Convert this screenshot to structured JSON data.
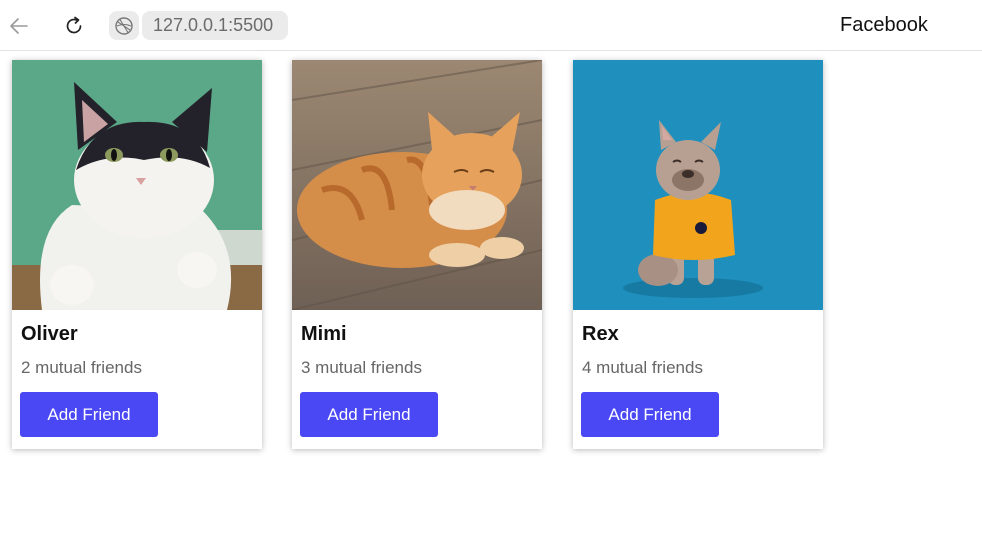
{
  "browser": {
    "address": "127.0.0.1:5500",
    "page_title": "Facebook",
    "icons": [
      "back-arrow-icon",
      "reload-icon",
      "site-info-icon"
    ]
  },
  "cards": [
    {
      "name": "Oliver",
      "mutual": "2 mutual friends",
      "button": "Add Friend",
      "photo": "black-white-cat-photo"
    },
    {
      "name": "Mimi",
      "mutual": "3 mutual friends",
      "button": "Add Friend",
      "photo": "orange-tabby-cat-photo"
    },
    {
      "name": "Rex",
      "mutual": "4 mutual friends",
      "button": "Add Friend",
      "photo": "french-bulldog-photo"
    }
  ],
  "colors": {
    "button": "#4a48f5",
    "photo_bg_1": "#5aa887",
    "photo_bg_3": "#1f8fbd"
  }
}
